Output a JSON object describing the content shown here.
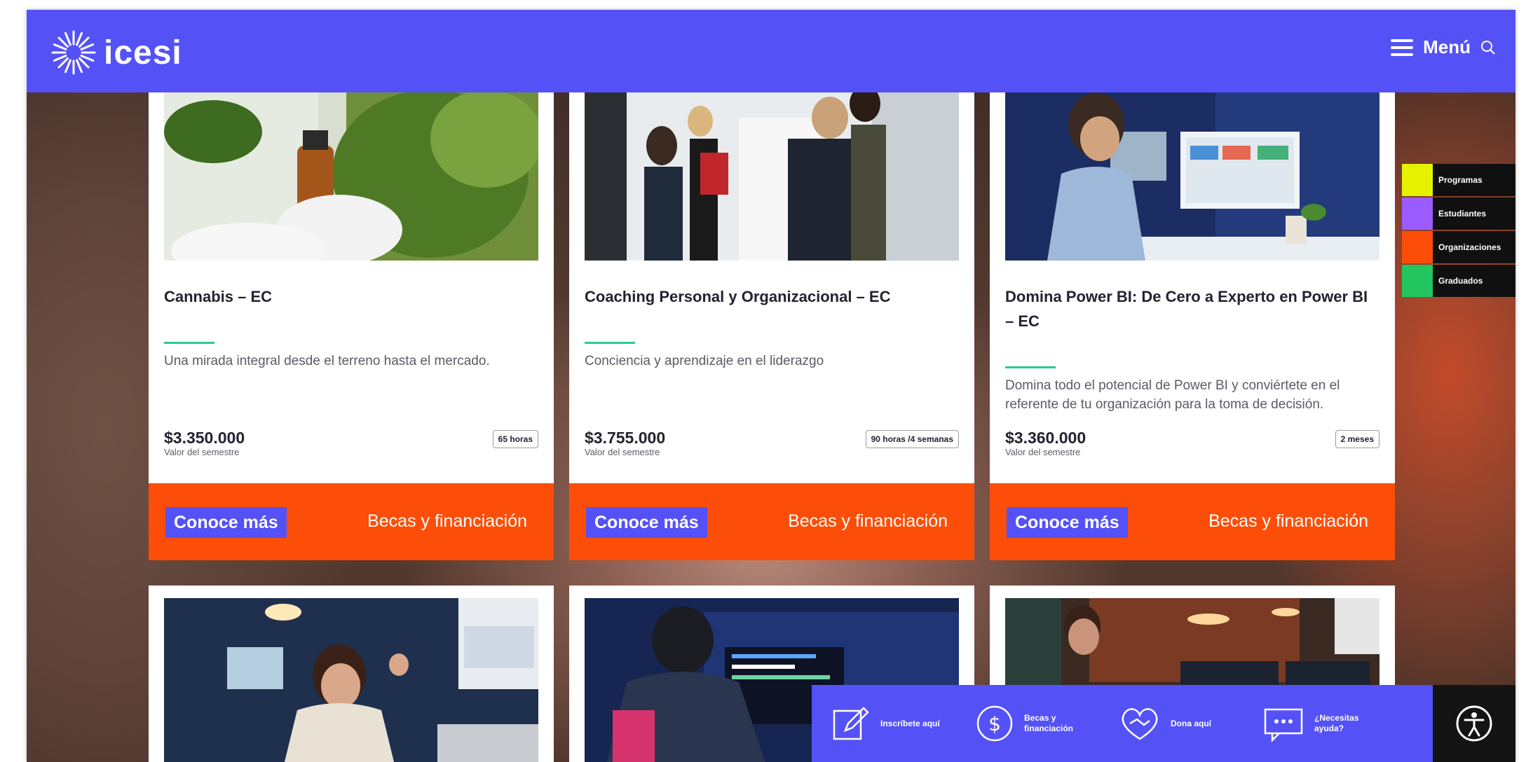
{
  "header": {
    "logo_text": "icesi",
    "menu_label": "Menú",
    "bg_color": "#5452f6"
  },
  "cards": [
    {
      "title": "Cannabis – EC",
      "description": "Una mirada integral desde el terreno hasta el mercado.",
      "price": "$3.350.000",
      "price_label": "Valor del semestre",
      "duration": "65 horas",
      "cta": "Conoce más",
      "secondary": "Becas y financiación"
    },
    {
      "title": "Coaching Personal y Organizacional – EC",
      "description": "Conciencia y aprendizaje en el liderazgo",
      "price": "$3.755.000",
      "price_label": "Valor del semestre",
      "duration": "90 horas /4 semanas",
      "cta": "Conoce más",
      "secondary": "Becas y financiación"
    },
    {
      "title": "Domina Power BI: De Cero a Experto en Power BI – EC",
      "description": "Domina todo el potencial de Power BI y conviértete en el referente de tu organización para la toma de decisión.",
      "price": "$3.360.000",
      "price_label": "Valor del semestre",
      "duration": "2 meses",
      "cta": "Conoce más",
      "secondary": "Becas y financiación"
    }
  ],
  "side_tabs": [
    {
      "label": "Programas",
      "color": "#e4f200"
    },
    {
      "label": "Estudiantes",
      "color": "#9b5cff"
    },
    {
      "label": "Organizaciones",
      "color": "#fd4e09"
    },
    {
      "label": "Graduados",
      "color": "#22c55e"
    }
  ],
  "bottom_bar": [
    {
      "label": "Inscríbete aquí",
      "icon": "edit-icon"
    },
    {
      "label": "Becas y financiación",
      "icon": "dollar-icon"
    },
    {
      "label": "Dona aquí",
      "icon": "handshake-heart-icon"
    },
    {
      "label": "¿Necesitas ayuda?",
      "icon": "chat-icon"
    }
  ],
  "colors": {
    "primary": "#5452f6",
    "accent": "#fd4e09",
    "divider": "#2cc79a"
  }
}
